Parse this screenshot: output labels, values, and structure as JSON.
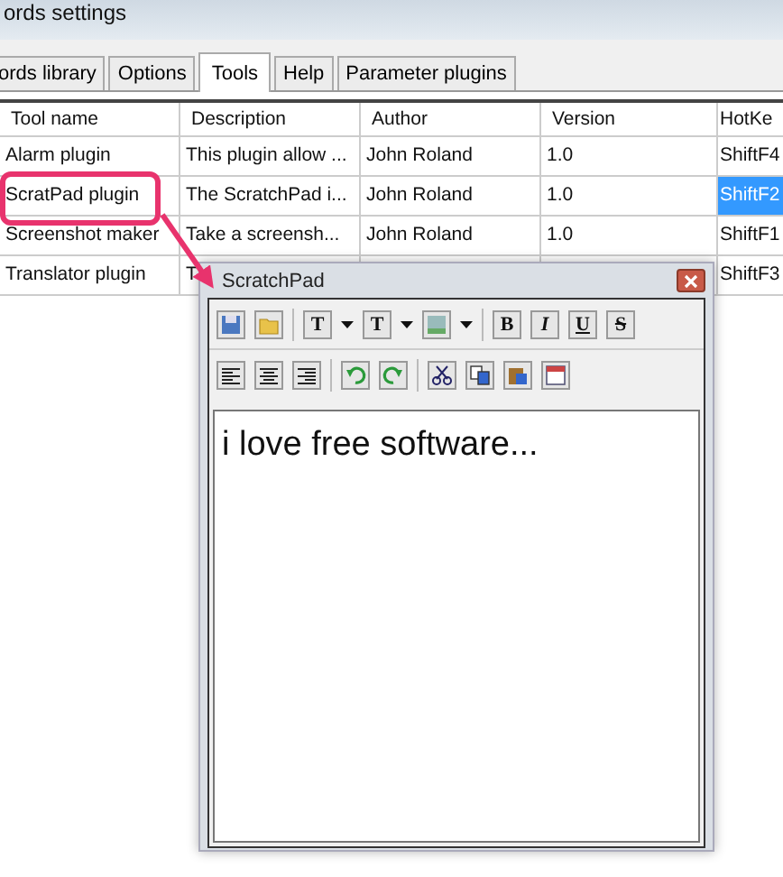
{
  "window": {
    "title": "ords settings"
  },
  "tabs": [
    {
      "label": "ords library",
      "selected": false
    },
    {
      "label": "Options",
      "selected": false
    },
    {
      "label": "Tools",
      "selected": true
    },
    {
      "label": "Help",
      "selected": false
    },
    {
      "label": "Parameter plugins",
      "selected": false
    }
  ],
  "table": {
    "columns": [
      "Tool name",
      "Description",
      "Author",
      "Version",
      "HotKe"
    ],
    "rows": [
      {
        "cells": [
          "Alarm plugin",
          "This plugin allow ...",
          "John Roland",
          "1.0",
          "ShiftF4"
        ],
        "selected": false
      },
      {
        "cells": [
          "ScratPad plugin",
          "The ScratchPad i...",
          "John Roland",
          "1.0",
          "ShiftF2"
        ],
        "selected": true
      },
      {
        "cells": [
          "Screenshot maker",
          "Take a screensh...",
          "John Roland",
          "1.0",
          "ShiftF1"
        ],
        "selected": false
      },
      {
        "cells": [
          "Translator plugin",
          "T",
          "",
          "",
          "ShiftF3"
        ],
        "selected": false
      }
    ]
  },
  "scratchpad": {
    "title": "ScratchPad",
    "font_buttons": [
      "T",
      "T"
    ],
    "format_buttons": [
      "B",
      "I",
      "U",
      "S"
    ],
    "text": "i love free software..."
  }
}
